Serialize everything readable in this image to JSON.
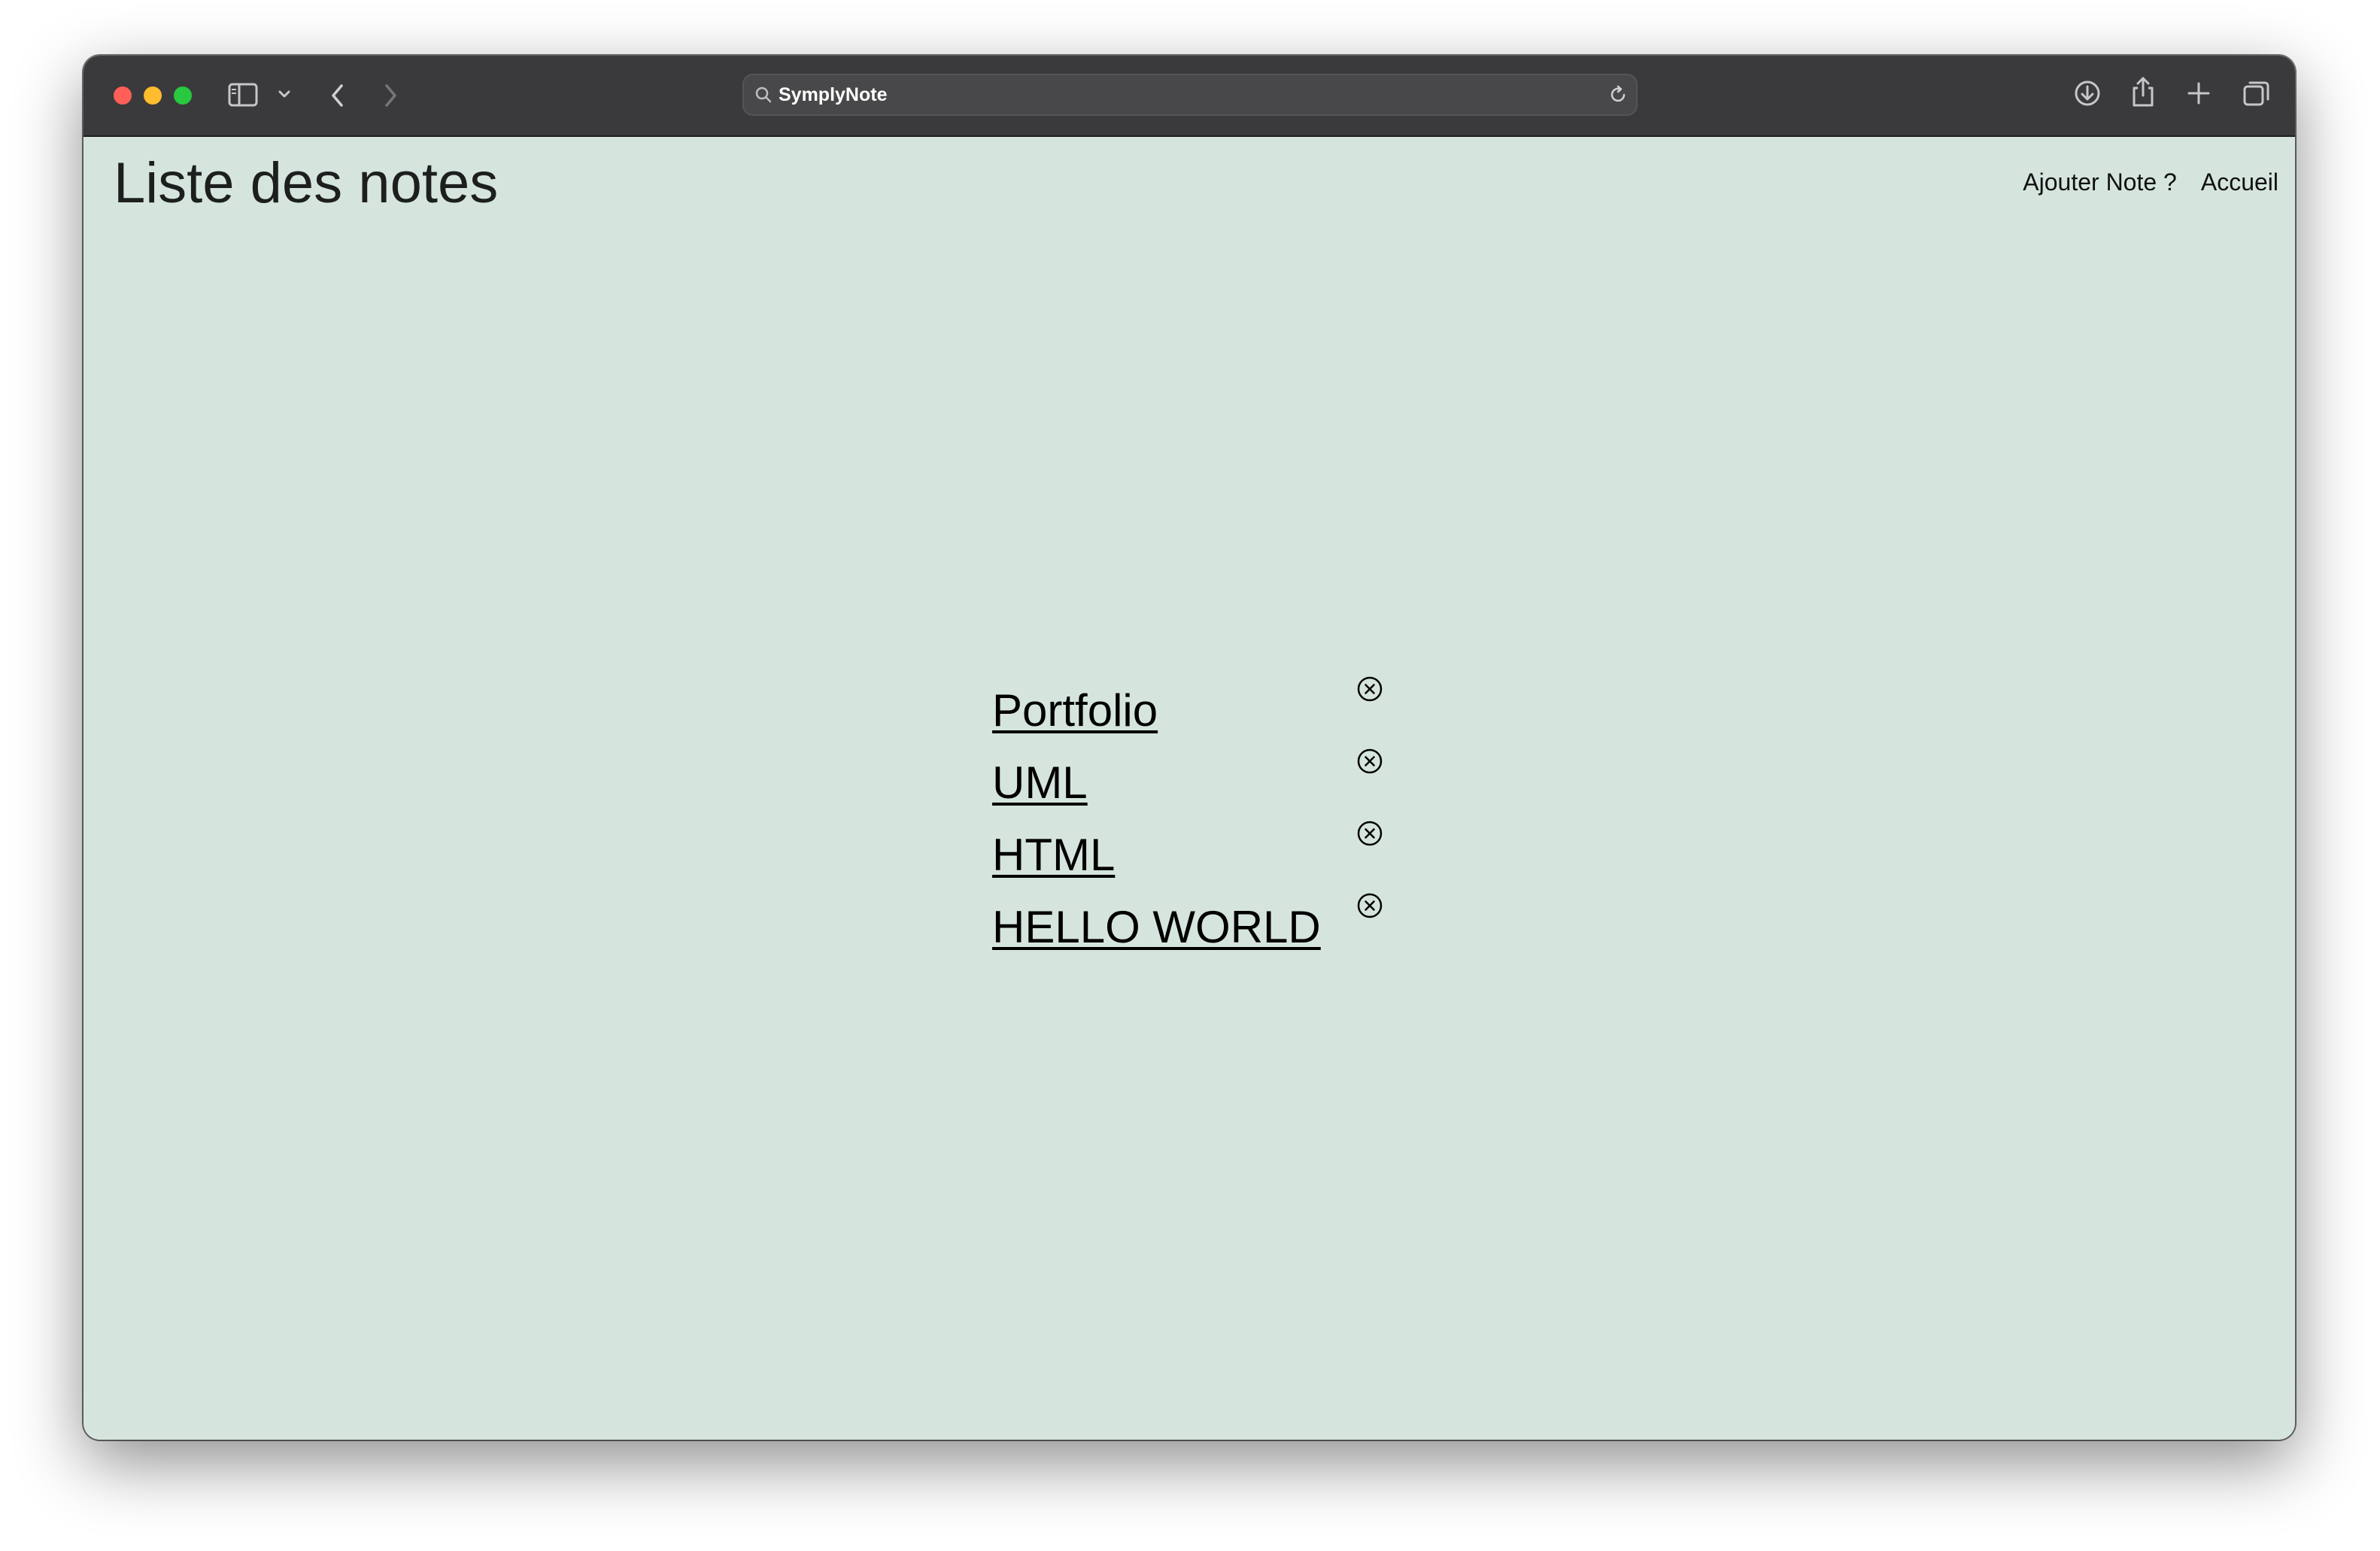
{
  "browser": {
    "address_bar": {
      "url_text": "SymplyNote"
    },
    "icons": {
      "sidebar": "sidebar-icon",
      "sidebar_menu": "chevron-down-icon",
      "back": "chevron-left-icon",
      "forward": "chevron-right-icon",
      "search": "search-icon",
      "reload": "reload-icon",
      "downloads": "download-icon",
      "share": "share-icon",
      "new_tab": "plus-icon",
      "tabs_overview": "tabs-icon"
    },
    "colors": {
      "toolbar": "#3a3a3c",
      "close": "#ff5f57",
      "minimize": "#febc2e",
      "maximize": "#28c840"
    }
  },
  "page": {
    "title": "Liste des notes",
    "background": "#d5e5dd",
    "nav": {
      "add_note": "Ajouter Note ?",
      "home": "Accueil"
    },
    "notes": [
      {
        "title": "Portfolio"
      },
      {
        "title": "UML"
      },
      {
        "title": "HTML"
      },
      {
        "title": "HELLO WORLD"
      }
    ],
    "delete_icon": "close-circle-icon"
  }
}
